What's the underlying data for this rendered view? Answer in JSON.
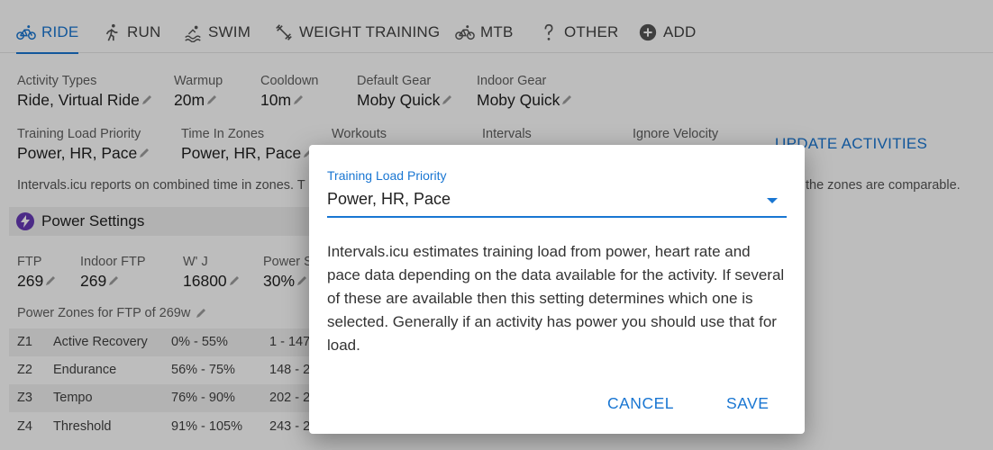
{
  "tabs": [
    {
      "label": "RIDE",
      "icon": "bike-icon",
      "active": true
    },
    {
      "label": "RUN",
      "icon": "run-icon"
    },
    {
      "label": "SWIM",
      "icon": "swim-icon"
    },
    {
      "label": "WEIGHT TRAINING",
      "icon": "dumbbell-icon"
    },
    {
      "label": "MTB",
      "icon": "bike-icon"
    },
    {
      "label": "OTHER",
      "icon": "question-icon"
    },
    {
      "label": "ADD",
      "icon": "plus-circle-icon"
    }
  ],
  "settings": {
    "activity_types": {
      "label": "Activity Types",
      "value": "Ride, Virtual Ride"
    },
    "warmup": {
      "label": "Warmup",
      "value": "20m"
    },
    "cooldown": {
      "label": "Cooldown",
      "value": "10m"
    },
    "default_gear": {
      "label": "Default Gear",
      "value": "Moby Quick"
    },
    "indoor_gear": {
      "label": "Indoor Gear",
      "value": "Moby Quick"
    },
    "training_load_priority": {
      "label": "Training Load Priority",
      "value": "Power, HR, Pace"
    },
    "time_in_zones": {
      "label": "Time In Zones",
      "value": "Power, HR, Pace"
    },
    "workouts": {
      "label": "Workouts"
    },
    "intervals": {
      "label": "Intervals"
    },
    "ignore_velocity": {
      "label": "Ignore Velocity"
    },
    "update_activities": "UPDATE ACTIVITIES",
    "note_left": "Intervals.icu reports on combined time in zones. T",
    "note_right": "the zones are comparable."
  },
  "power": {
    "section_title": "Power Settings",
    "ftp": {
      "label": "FTP",
      "value": "269"
    },
    "indoor_ftp": {
      "label": "Indoor FTP",
      "value": "269"
    },
    "w_prime": {
      "label": "W' J",
      "value": "16800"
    },
    "power_s": {
      "label": "Power S",
      "value": "30%"
    },
    "zones_title": "Power Zones for FTP of 269w",
    "zones": [
      {
        "id": "Z1",
        "name": "Active Recovery",
        "pct": "0% - 55%",
        "watts": "1 - 147"
      },
      {
        "id": "Z2",
        "name": "Endurance",
        "pct": "56% - 75%",
        "watts": "148 - 2"
      },
      {
        "id": "Z3",
        "name": "Tempo",
        "pct": "76% - 90%",
        "watts": "202 - 2"
      },
      {
        "id": "Z4",
        "name": "Threshold",
        "pct": "91% - 105%",
        "watts": "243 - 2"
      }
    ]
  },
  "dialog": {
    "label": "Training Load Priority",
    "selected": "Power, HR, Pace",
    "description": "Intervals.icu estimates training load from power, heart rate and pace data depending on the data available for the activity. If several of these are available then this setting determines which one is selected. Generally if an activity has power you should use that for load.",
    "cancel": "CANCEL",
    "save": "SAVE"
  },
  "colors": {
    "accent": "#1976d2",
    "power_icon": "#673ab7"
  }
}
